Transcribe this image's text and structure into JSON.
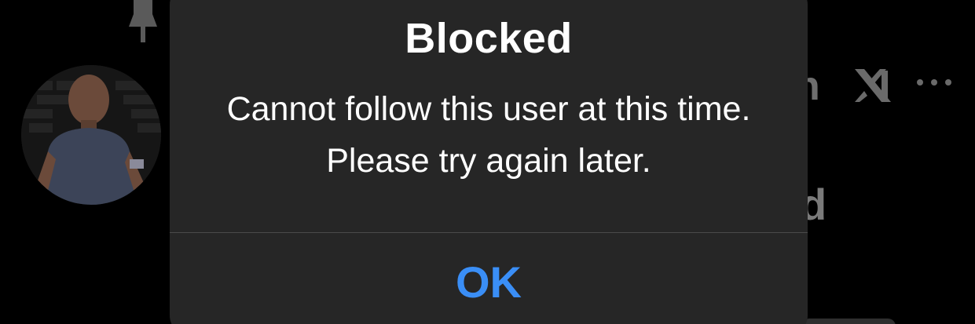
{
  "alert": {
    "title": "Blocked",
    "message": "Cannot follow this user at this time. Please try again later.",
    "ok_label": "OK"
  },
  "background": {
    "partial_text_1": "n",
    "partial_text_2": "d"
  },
  "icons": {
    "pin": "pin-icon",
    "x_logo": "x-logo-icon",
    "more": "more-icon"
  },
  "colors": {
    "background": "#000000",
    "alert_surface": "#262626",
    "accent": "#3a8ef6",
    "text": "#ffffff",
    "divider": "#4a4a4a"
  }
}
